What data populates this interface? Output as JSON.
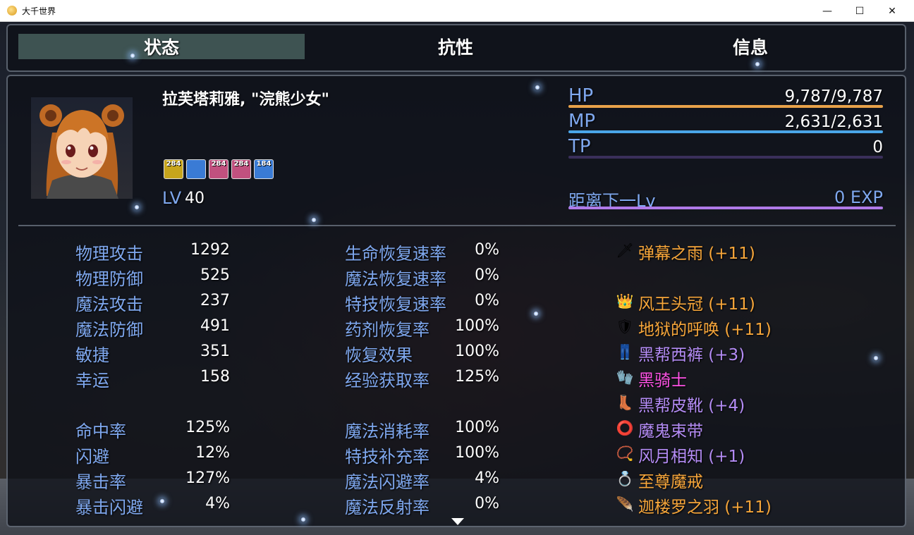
{
  "window": {
    "title": "大千世界",
    "minimize": "—",
    "maximize": "☐",
    "close": "✕"
  },
  "tabs": [
    {
      "label": "状态",
      "active": true
    },
    {
      "label": "抗性",
      "active": false
    },
    {
      "label": "信息",
      "active": false
    }
  ],
  "actor": {
    "name": "拉芙塔莉雅, \"浣熊少女\"",
    "level_label": "LV",
    "level": "40",
    "states": [
      {
        "text": "284",
        "color": "#c7a51c",
        "icon": "ankh-icon"
      },
      {
        "text": "",
        "color": "#3a7bd5",
        "icon": "swirl-icon"
      },
      {
        "text": "284",
        "color": "#c1517f",
        "icon": "heart-icon"
      },
      {
        "text": "284",
        "color": "#c1517f",
        "icon": "shield-icon"
      },
      {
        "text": "184",
        "color": "#3a7bd5",
        "icon": "wave-icon"
      }
    ]
  },
  "gauges": {
    "hp": {
      "label": "HP",
      "value": "9,787/9,787",
      "fill": 1.0,
      "color": "#e8a24a"
    },
    "mp": {
      "label": "MP",
      "value": "2,631/2,631",
      "fill": 1.0,
      "color": "#4aa6e8"
    },
    "tp": {
      "label": "TP",
      "value": "0",
      "fill": 0.0,
      "color": "#4b3c6a"
    },
    "exp": {
      "label": "距离下一Lv",
      "value": "0 EXP",
      "fill": 1.0,
      "color": "#b07ae8"
    }
  },
  "params_a": [
    {
      "name": "物理攻击",
      "value": "1292"
    },
    {
      "name": "物理防御",
      "value": "525"
    },
    {
      "name": "魔法攻击",
      "value": "237"
    },
    {
      "name": "魔法防御",
      "value": "491"
    },
    {
      "name": "敏捷",
      "value": "351"
    },
    {
      "name": "幸运",
      "value": "158"
    }
  ],
  "params_b": [
    {
      "name": "命中率",
      "value": "125%"
    },
    {
      "name": "闪避",
      "value": "12%"
    },
    {
      "name": "暴击率",
      "value": "127%"
    },
    {
      "name": "暴击闪避",
      "value": "4%"
    }
  ],
  "params_c": [
    {
      "name": "生命恢复速率",
      "value": "0%"
    },
    {
      "name": "魔法恢复速率",
      "value": "0%"
    },
    {
      "name": "特技恢复速率",
      "value": "0%"
    },
    {
      "name": "药剂恢复率",
      "value": "100%"
    },
    {
      "name": "恢复效果",
      "value": "100%"
    },
    {
      "name": "经验获取率",
      "value": "125%"
    }
  ],
  "params_d": [
    {
      "name": "魔法消耗率",
      "value": "100%"
    },
    {
      "name": "特技补充率",
      "value": "100%"
    },
    {
      "name": "魔法闪避率",
      "value": "4%"
    },
    {
      "name": "魔法反射率",
      "value": "0%"
    }
  ],
  "equipment": [
    {
      "name": "弹幕之雨 (+11)",
      "icon": "dagger-icon",
      "glyph": "🗡",
      "color": "#f7a63a"
    },
    {
      "name": "风王头冠 (+11)",
      "icon": "circlet-icon",
      "glyph": "👑",
      "color": "#f7a63a"
    },
    {
      "name": "地狱的呼唤 (+11)",
      "icon": "armor-icon",
      "glyph": "🛡",
      "color": "#f7a63a"
    },
    {
      "name": "黑帮西裤 (+3)",
      "icon": "pants-icon",
      "glyph": "👖",
      "color": "#b48cf5"
    },
    {
      "name": "黑骑士",
      "icon": "gauntlet-icon",
      "glyph": "🧤",
      "color": "#ff52e6"
    },
    {
      "name": "黑帮皮靴 (+4)",
      "icon": "boots-icon",
      "glyph": "👢",
      "color": "#b48cf5"
    },
    {
      "name": "魔鬼束带",
      "icon": "belt-icon",
      "glyph": "⭕",
      "color": "#b48cf5"
    },
    {
      "name": "风月相知 (+1)",
      "icon": "necklace-icon",
      "glyph": "📿",
      "color": "#b48cf5"
    },
    {
      "name": "至尊魔戒",
      "icon": "ring-icon",
      "glyph": "💍",
      "color": "#f7a63a"
    },
    {
      "name": "迦楼罗之羽 (+11)",
      "icon": "feather-icon",
      "glyph": "🪶",
      "color": "#f7a63a"
    }
  ]
}
